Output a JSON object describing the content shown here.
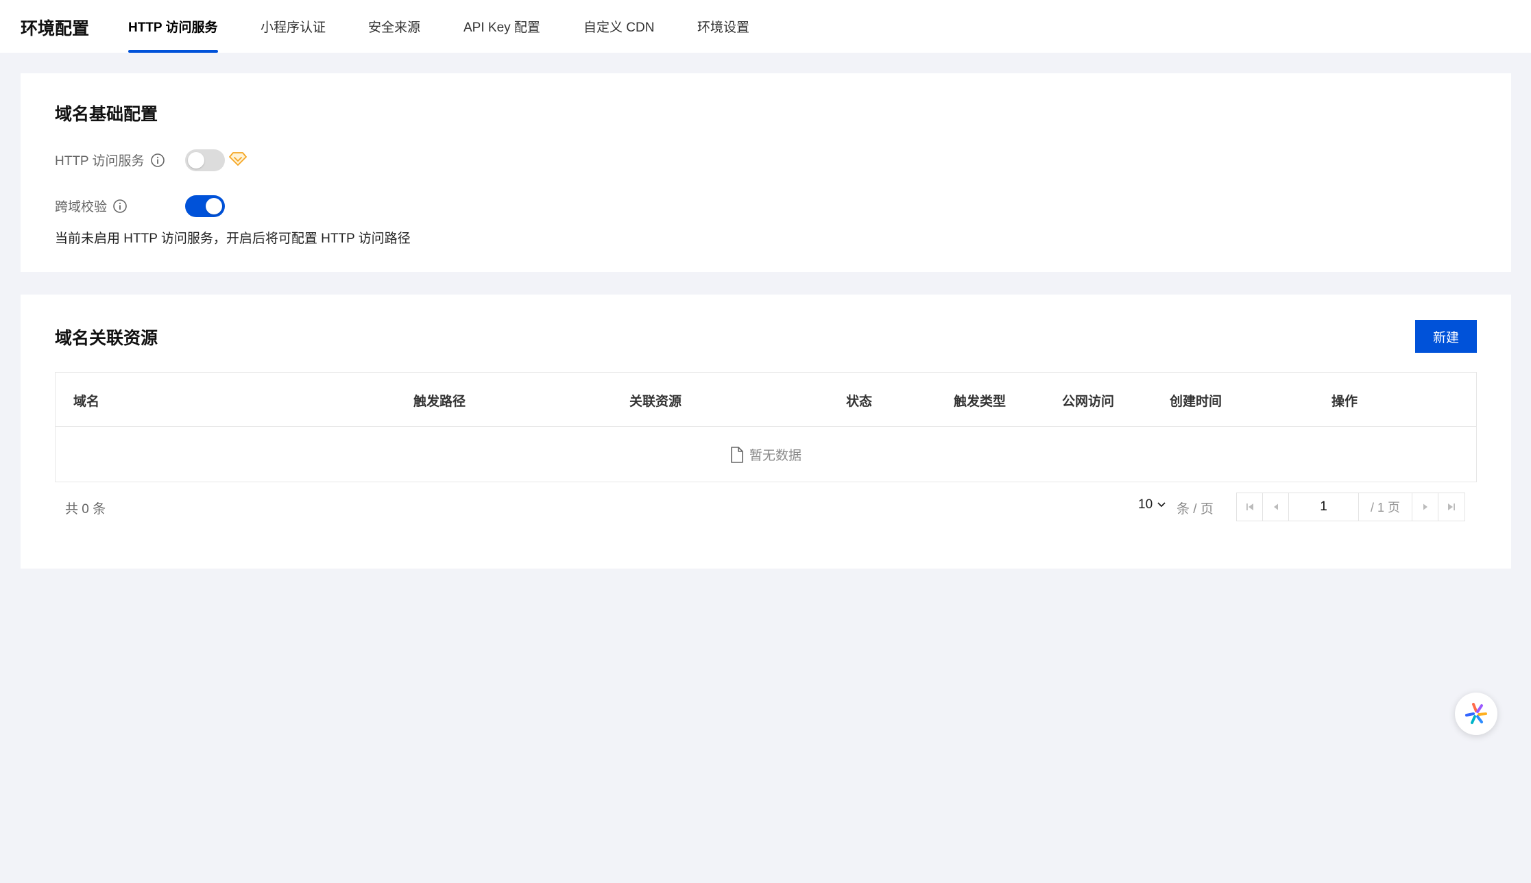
{
  "header": {
    "title": "环境配置",
    "tabs": [
      {
        "label": "HTTP 访问服务",
        "active": true
      },
      {
        "label": "小程序认证"
      },
      {
        "label": "安全来源"
      },
      {
        "label": "API Key 配置"
      },
      {
        "label": "自定义 CDN"
      },
      {
        "label": "环境设置"
      }
    ]
  },
  "basic": {
    "title": "域名基础配置",
    "http_label": "HTTP 访问服务",
    "http_enabled": false,
    "cors_label": "跨域校验",
    "cors_enabled": true,
    "hint": "当前未启用 HTTP 访问服务，开启后将可配置 HTTP 访问路径"
  },
  "resources": {
    "title": "域名关联资源",
    "new_button": "新建",
    "columns": [
      "域名",
      "触发路径",
      "关联资源",
      "状态",
      "触发类型",
      "公网访问",
      "创建时间",
      "操作"
    ],
    "empty_text": "暂无数据",
    "total": "共 0 条",
    "page_size": "10",
    "page_size_unit": "条 / 页",
    "current_page": "1",
    "total_pages": "/ 1 页"
  },
  "colors": {
    "primary": "#0052d9",
    "page_bg": "#f2f3f8"
  }
}
